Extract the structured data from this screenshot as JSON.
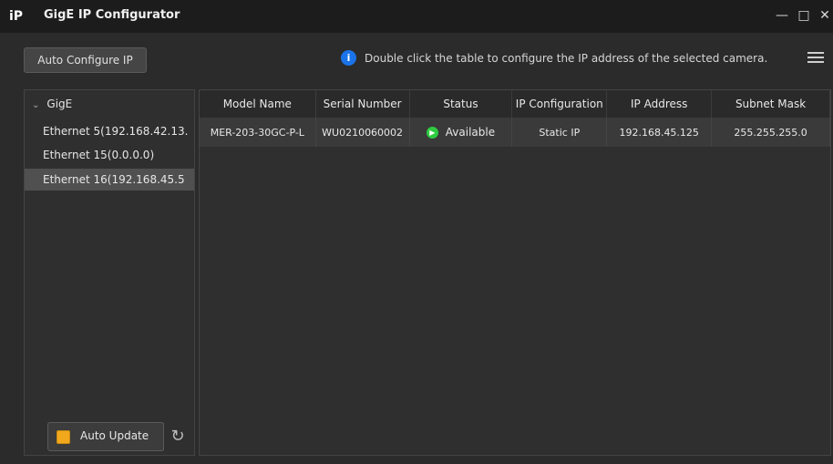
{
  "window": {
    "logo": "iP",
    "title": "GigE IP Configurator",
    "controls": [
      "minimize-icon",
      "maximize-icon",
      "close-icon"
    ]
  },
  "toolbar": {
    "auto_configure_label": "Auto Configure IP",
    "info_icon": "info-icon",
    "info_text": "Double click the table to configure the IP address of the selected camera.",
    "menu_icon": "hamburger-menu-icon"
  },
  "tree": {
    "root_label": "GigE",
    "items": [
      {
        "label": "Ethernet 5(192.168.42.13.",
        "selected": false
      },
      {
        "label": "Ethernet 15(0.0.0.0)",
        "selected": false
      },
      {
        "label": "Ethernet 16(192.168.45.5",
        "selected": true
      }
    ]
  },
  "auto_update": {
    "label": "Auto Update",
    "checked": true,
    "check_color": "#f2a81d",
    "refresh_icon": "refresh-icon"
  },
  "table": {
    "columns": [
      "Model Name",
      "Serial Number",
      "Status",
      "IP Configuration",
      "IP Address",
      "Subnet Mask"
    ],
    "rows": [
      {
        "model": "MER-203-30GC-P-L",
        "serial": "WU0210060002",
        "status": "Available",
        "status_color": "#2ecc40",
        "ip_config": "Static IP",
        "ip": "192.168.45.125",
        "mask": "255.255.255.0"
      }
    ]
  },
  "colors": {
    "accent": "#1a73e8",
    "background": "#2b2b2b"
  }
}
